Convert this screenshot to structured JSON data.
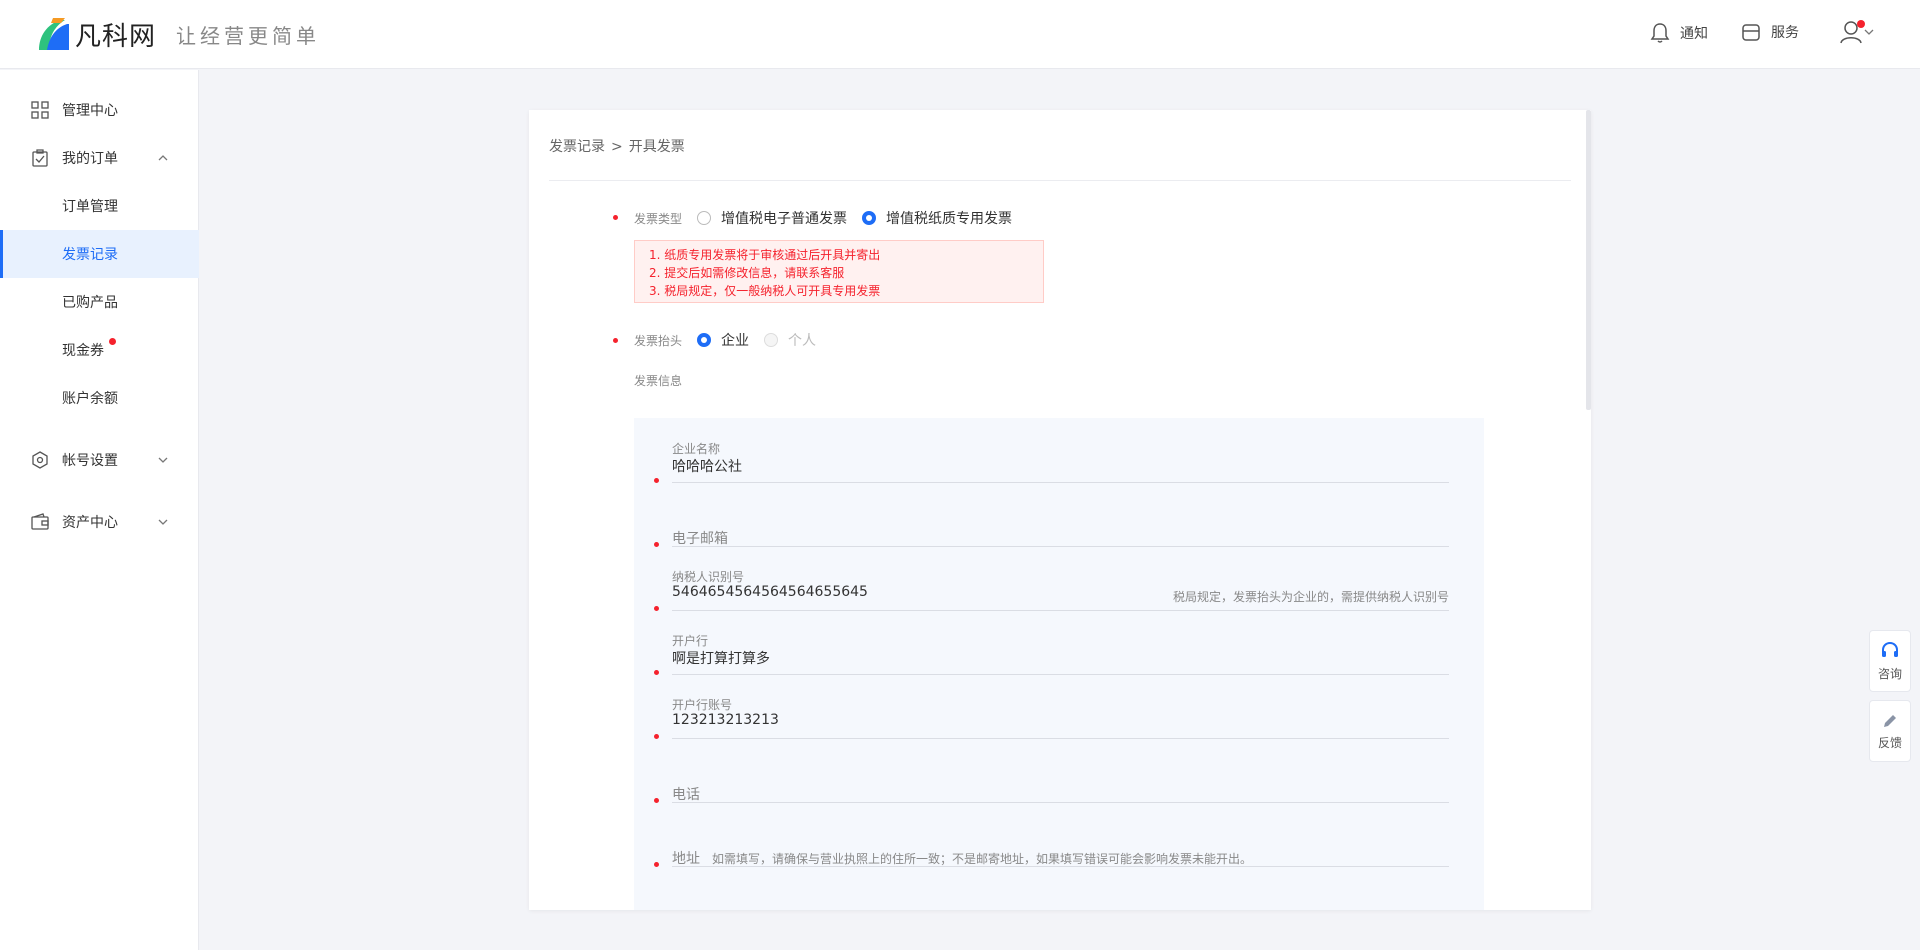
{
  "header": {
    "logo_text": "凡科网",
    "slogan": "让经营更简单",
    "notify_label": "通知",
    "service_label": "服务"
  },
  "sidebar": {
    "items": [
      {
        "label": "管理中心",
        "icon": "grid-icon"
      },
      {
        "label": "我的订单",
        "icon": "clipboard-check-icon",
        "expanded": true
      },
      {
        "label": "订单管理"
      },
      {
        "label": "发票记录",
        "active": true
      },
      {
        "label": "已购产品"
      },
      {
        "label": "现金券",
        "badge": true
      },
      {
        "label": "账户余额"
      },
      {
        "label": "帐号设置",
        "icon": "gear-hex-icon"
      },
      {
        "label": "资产中心",
        "icon": "wallet-icon"
      }
    ]
  },
  "breadcrumb": {
    "parent": "发票记录",
    "separator": ">",
    "current": "开具发票"
  },
  "form": {
    "invoice_type_label": "发票类型",
    "invoice_type_options": [
      "增值税电子普通发票",
      "增值税纸质专用发票"
    ],
    "invoice_type_selected": "增值税纸质专用发票",
    "notice_lines": [
      "1. 纸质专用发票将于审核通过后开具并寄出",
      "2. 提交后如需修改信息，请联系客服",
      "3. 税局规定，仅一般纳税人可开具专用发票"
    ],
    "title_label": "发票抬头",
    "title_options": [
      "企业",
      "个人"
    ],
    "title_selected": "企业",
    "info_label": "发票信息",
    "company_name_label": "企业名称",
    "company_name_value": "哈哈哈公社",
    "email_placeholder": "电子邮箱",
    "tax_id_label": "纳税人识别号",
    "tax_id_value": "5464654564564564655645",
    "tax_id_hint": "税局规定，发票抬头为企业的，需提供纳税人识别号",
    "bank_label": "开户行",
    "bank_value": "啊是打算打算多",
    "account_label": "开户行账号",
    "account_value": "123213213213",
    "phone_placeholder": "电话",
    "address_placeholder": "地址",
    "address_hint": "如需填写，请确保与营业执照上的住所一致；不是邮寄地址，如果填写错误可能会影响发票未能开出。"
  },
  "float_tools": {
    "consult_label": "咨询",
    "feedback_label": "反馈"
  },
  "colors": {
    "primary": "#1e6df6",
    "danger": "#f5222d",
    "background": "#f3f4f8"
  }
}
